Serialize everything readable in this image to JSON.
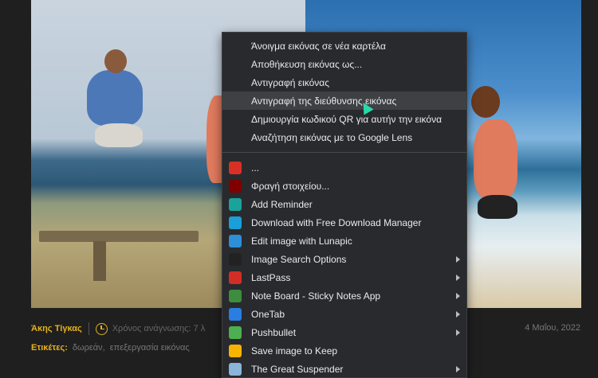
{
  "article": {
    "author": "Άκης Τίγκας",
    "read_time": "Χρόνος ανάγνωσης: 7 λ",
    "date": "4 Μαΐου, 2022",
    "tags_label": "Ετικέτες:",
    "tags": [
      "δωρεάν,",
      "επεξεργασία εικόνας"
    ]
  },
  "context_menu": {
    "image_items": [
      "Άνοιγμα εικόνας σε νέα καρτέλα",
      "Αποθήκευση εικόνας ως...",
      "Αντιγραφή εικόνας",
      "Αντιγραφή της διεύθυνσης εικόνας",
      "Δημιουργία κωδικού QR για αυτήν την εικόνα",
      "Αναζήτηση εικόνας με το Google Lens"
    ],
    "extension_items": [
      {
        "label": "...",
        "icon": "gmail-icon",
        "color": "#d93025",
        "submenu": false
      },
      {
        "label": "Φραγή στοιχείου...",
        "icon": "ublock-icon",
        "color": "#800000",
        "submenu": false
      },
      {
        "label": "Add Reminder",
        "icon": "reminder-icon",
        "color": "#1aa39a",
        "submenu": false
      },
      {
        "label": "Download with Free Download Manager",
        "icon": "fdm-icon",
        "color": "#1a9fd8",
        "submenu": false
      },
      {
        "label": "Edit image with Lunapic",
        "icon": "lunapic-icon",
        "color": "#2d8fd6",
        "submenu": false
      },
      {
        "label": "Image Search Options",
        "icon": "image-search-icon",
        "color": "#222222",
        "submenu": true
      },
      {
        "label": "LastPass",
        "icon": "lastpass-icon",
        "color": "#d32d27",
        "submenu": true
      },
      {
        "label": "Note Board - Sticky Notes App",
        "icon": "note-board-icon",
        "color": "#3c8d3f",
        "submenu": true
      },
      {
        "label": "OneTab",
        "icon": "onetab-icon",
        "color": "#2a7de1",
        "submenu": true
      },
      {
        "label": "Pushbullet",
        "icon": "pushbullet-icon",
        "color": "#4caf50",
        "submenu": true
      },
      {
        "label": "Save image to Keep",
        "icon": "keep-icon",
        "color": "#f6b400",
        "submenu": false
      },
      {
        "label": "The Great Suspender",
        "icon": "great-suspender-icon",
        "color": "#8ab4d8",
        "submenu": true
      }
    ]
  }
}
